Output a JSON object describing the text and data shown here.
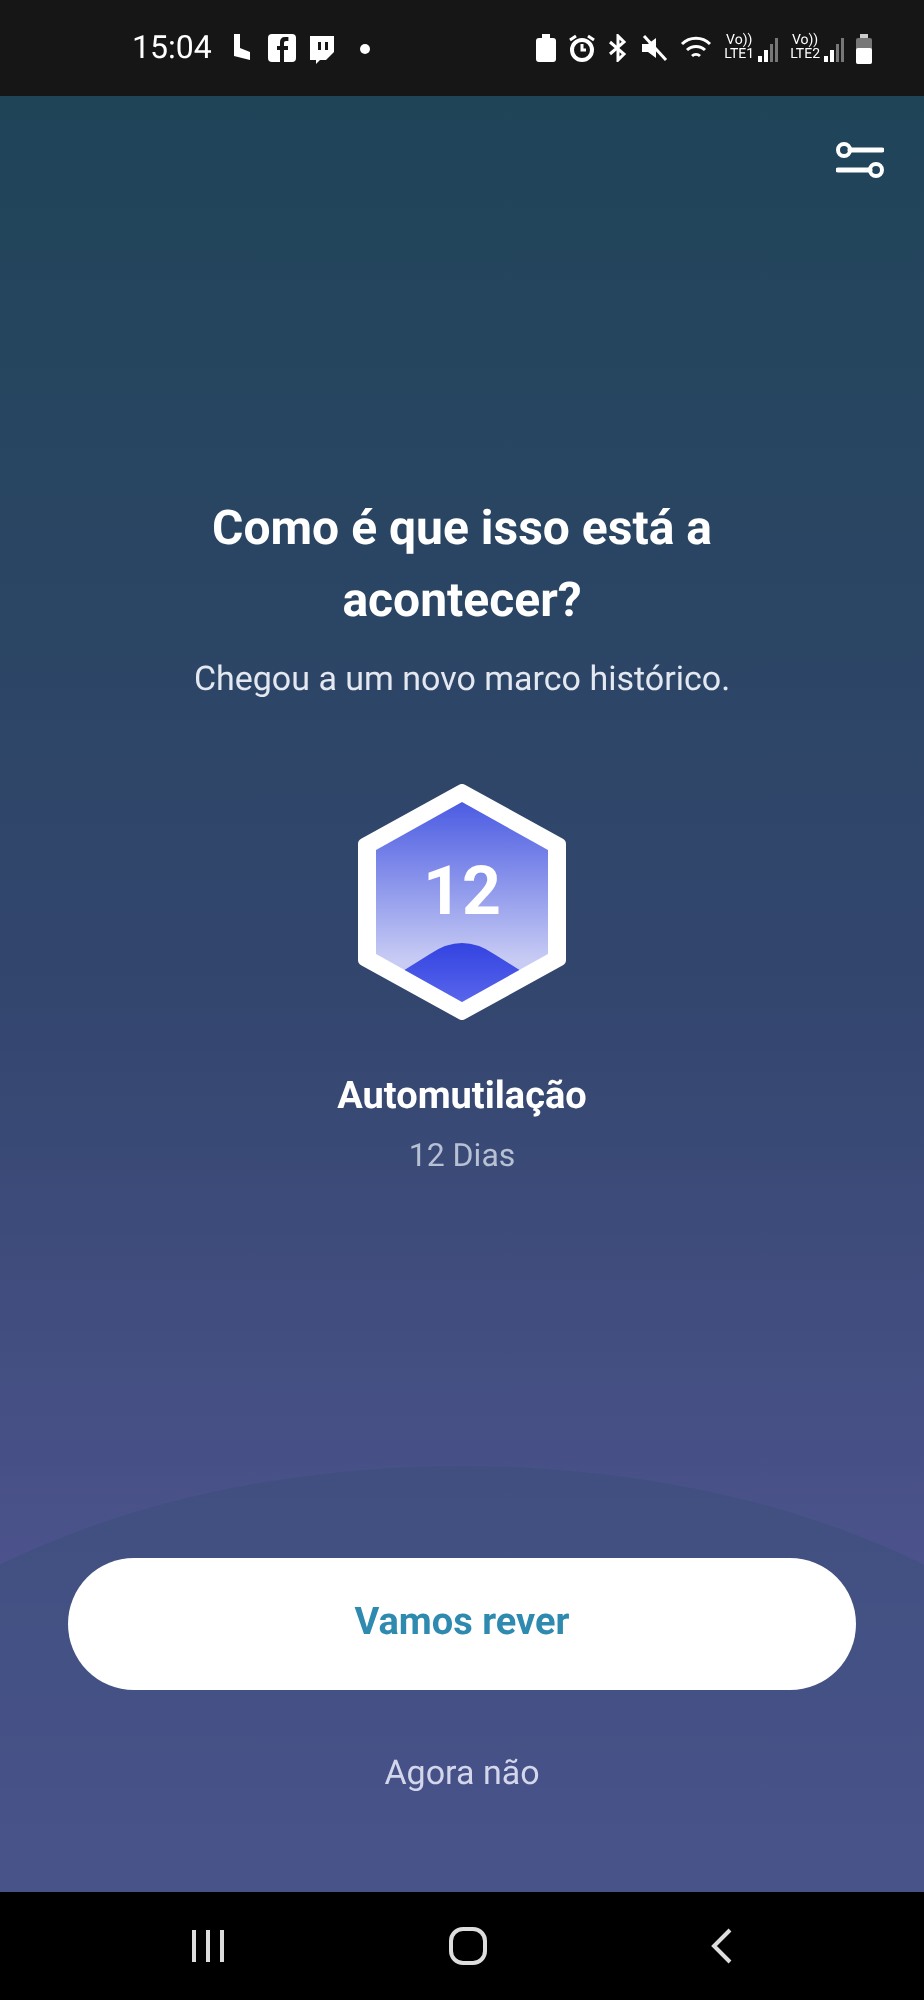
{
  "status_bar": {
    "time": "15:04",
    "sim_labels": [
      {
        "top": "Vo))",
        "bottom": "LTE1"
      },
      {
        "top": "Vo))",
        "bottom": "LTE2"
      }
    ]
  },
  "title": "Como é que isso está a acontecer?",
  "subtitle": "Chegou a um novo marco histórico.",
  "badge": {
    "number": "12",
    "name": "Automutilação",
    "duration": "12 Dias"
  },
  "primary_button": "Vamos rever",
  "secondary_link": "Agora não"
}
